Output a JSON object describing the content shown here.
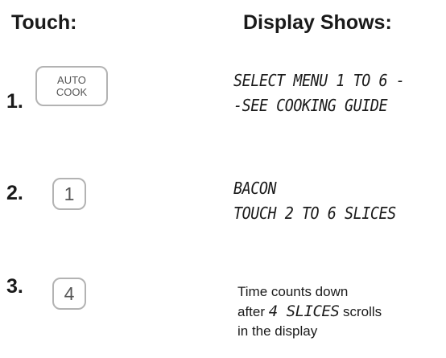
{
  "headers": {
    "touch": "Touch:",
    "display": "Display Shows:"
  },
  "steps": [
    {
      "number": "1.",
      "key_line1": "AUTO",
      "key_line2": "COOK",
      "display_line1": "SELECT MENU 1 TO 6 -",
      "display_line2": "-SEE COOKING GUIDE"
    },
    {
      "number": "2.",
      "key": "1",
      "display_line1": "BACON",
      "display_line2": "TOUCH 2 TO 6 SLICES"
    },
    {
      "number": "3.",
      "key": "4",
      "desc_line1": "Time counts down",
      "desc_after": "after",
      "desc_lcd": "4 SLICES",
      "desc_scrolls": "scrolls",
      "desc_line3": "in the display"
    }
  ]
}
